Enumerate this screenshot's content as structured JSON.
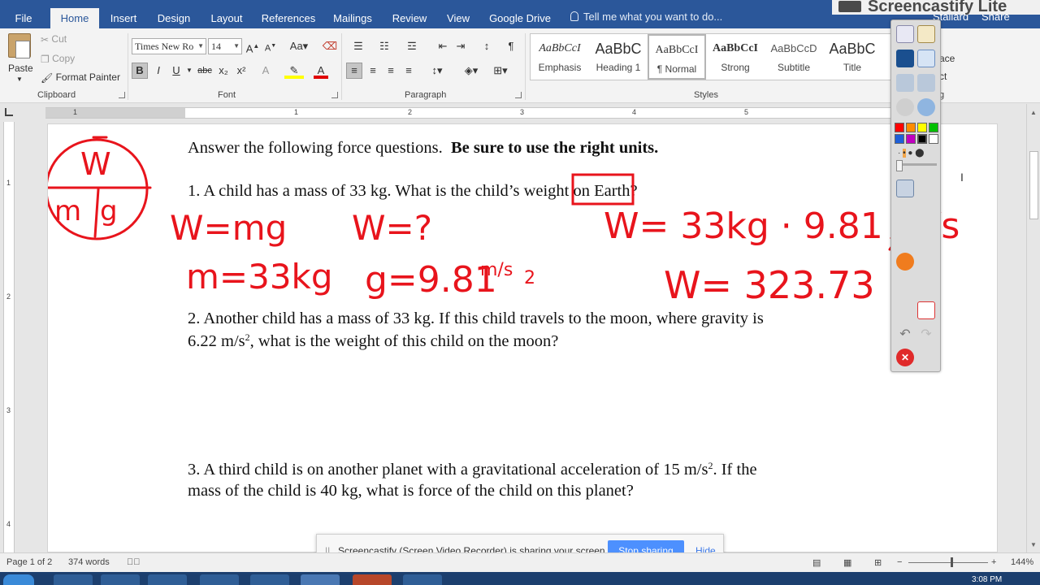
{
  "screencastify": {
    "title": "Screencastify Lite"
  },
  "tabs": [
    "File",
    "Home",
    "Insert",
    "Design",
    "Layout",
    "References",
    "Mailings",
    "Review",
    "View",
    "Google Drive"
  ],
  "tell_me": "Tell me what you want to do...",
  "user": "Stallard",
  "share": "Share",
  "clipboard": {
    "paste": "Paste",
    "cut": "Cut",
    "copy": "Copy",
    "format_painter": "Format Painter",
    "label": "Clipboard"
  },
  "font": {
    "name": "Times New Ro",
    "size": "14",
    "label": "Font",
    "bold": "B",
    "italic": "I",
    "underline": "U",
    "strike": "abc",
    "subscript": "x₂",
    "superscript": "x²"
  },
  "paragraph": {
    "label": "Paragraph"
  },
  "styles": {
    "label": "Styles",
    "items": [
      {
        "preview": "AaBbCcI",
        "name": "Emphasis"
      },
      {
        "preview": "AaBbC",
        "name": "Heading 1"
      },
      {
        "preview": "AaBbCcI",
        "name": "¶ Normal"
      },
      {
        "preview": "AaBbCcI",
        "name": "Strong"
      },
      {
        "preview": "AaBbCcD",
        "name": "Subtitle"
      },
      {
        "preview": "AaBbC",
        "name": "Title"
      }
    ]
  },
  "editing": {
    "replace": "ace",
    "select": "ct",
    "label": "g"
  },
  "ruler": {
    "numbers": [
      "1",
      "1",
      "2",
      "3",
      "4",
      "5"
    ]
  },
  "document": {
    "intro": "Answer the following force questions.",
    "intro_bold": "Be sure to use the right units.",
    "q1": "1.  A child has a mass of 33 kg.  What is the child’s weight on Earth?",
    "q2_line1": "2.  Another child has a mass of 33 kg.  If this child travels to the moon, where gravity is",
    "q2_line2_a": "6.22 m/s",
    "q2_line2_sup": "2",
    "q2_line2_b": ", what is the weight of this child on the moon?",
    "q3_line1_a": "3.  A third child is on another planet with a gravitational acceleration of 15 m/s",
    "q3_line1_sup": "2",
    "q3_line1_b": ". If the",
    "q3_line2": "mass of the child is 40 kg, what is force of the child on this planet?"
  },
  "ink": {
    "color": "#e8141c",
    "triangle_top": "W",
    "triangle_left": "m",
    "triangle_right": "g",
    "formula": "W=mg",
    "unknown": "W=?",
    "mass": "m=33kg",
    "gravity": "g=9.81",
    "gravity_unit": "m/s",
    "gravity_exp": "2",
    "substitution": "W= 33kg · 9.81 m/s",
    "result": "W= 323.73"
  },
  "share_bar": {
    "message": "Screencastify (Screen Video Recorder) is sharing your screen.",
    "stop": "Stop sharing",
    "hide": "Hide"
  },
  "status": {
    "page": "Page 1 of 2",
    "words": "374 words",
    "zoom": "144%"
  },
  "clock": "3:08 PM",
  "colors": {
    "word_blue": "#2b579a",
    "ink_red": "#e8141c",
    "stop_button": "#4d90fe"
  }
}
